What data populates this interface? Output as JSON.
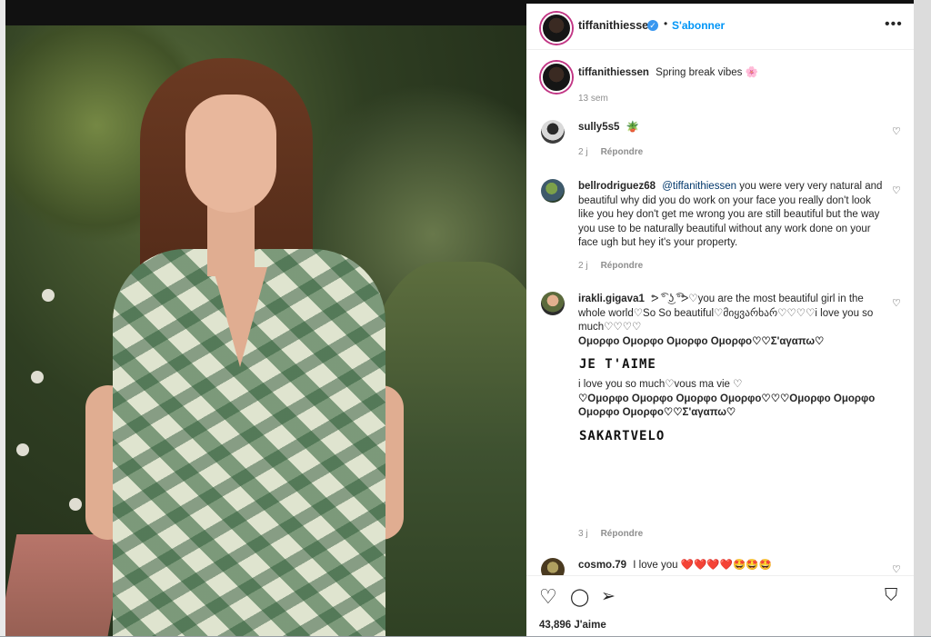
{
  "post": {
    "username": "tiffanithiessen",
    "verified_badge": "✓",
    "separator": "•",
    "follow_label": "S'abonner",
    "more_label": "•••",
    "caption": "Spring break vibes 🌸",
    "caption_age": "13 sem",
    "likes": "43,896 J'aime"
  },
  "comments": [
    {
      "user": "sully5s5",
      "text": "🪴",
      "age": "2 j",
      "reply": "Répondre"
    },
    {
      "user": "bellrodriguez68",
      "mention": "@tiffanithiessen",
      "text": "you were very very natural and beautiful why did you do work on your face you really don't look like you hey don't get me wrong you are still beautiful but the way you use to be naturally beautiful without any work done on your face ugh but hey it's your property.",
      "age": "2 j",
      "reply": "Répondre"
    },
    {
      "user": "irakli.gigava1",
      "text_line1": "ᕗ ͡° ͜ʖ ͡°ᕗ♡you are the most beautiful girl in the whole world♡So So beautiful♡მიყვარხარ♡♡♡♡i love you so much♡♡♡♡",
      "text_bold1": "Ομορφο Ομορφο Ομορφο Ομορφο♡♡Σ'αγαπω♡",
      "art1": "JE T'AIME",
      "text_line2": "i love you so much♡vous ma vie ♡",
      "text_bold2": "♡Ομορφο Ομορφο Ομορφο Ομορφο♡♡♡Ομορφο Ομορφο Ομορφο Ομορφο♡♡Σ'αγαπω♡",
      "art2": "SAKARTVELO",
      "age": "3 j",
      "reply": "Répondre"
    },
    {
      "user": "cosmo.79",
      "text": "I love you ❤️❤️❤️❤️🤩🤩🤩"
    }
  ],
  "actions": {
    "like_icon": "♡",
    "comment_icon": "◯",
    "share_icon": "➢",
    "save_icon": "⛉"
  },
  "colors": {
    "link_blue": "#0095f6",
    "verified": "#3897f0",
    "meta_gray": "#8e8e8e",
    "story_ring": "#c13584"
  }
}
